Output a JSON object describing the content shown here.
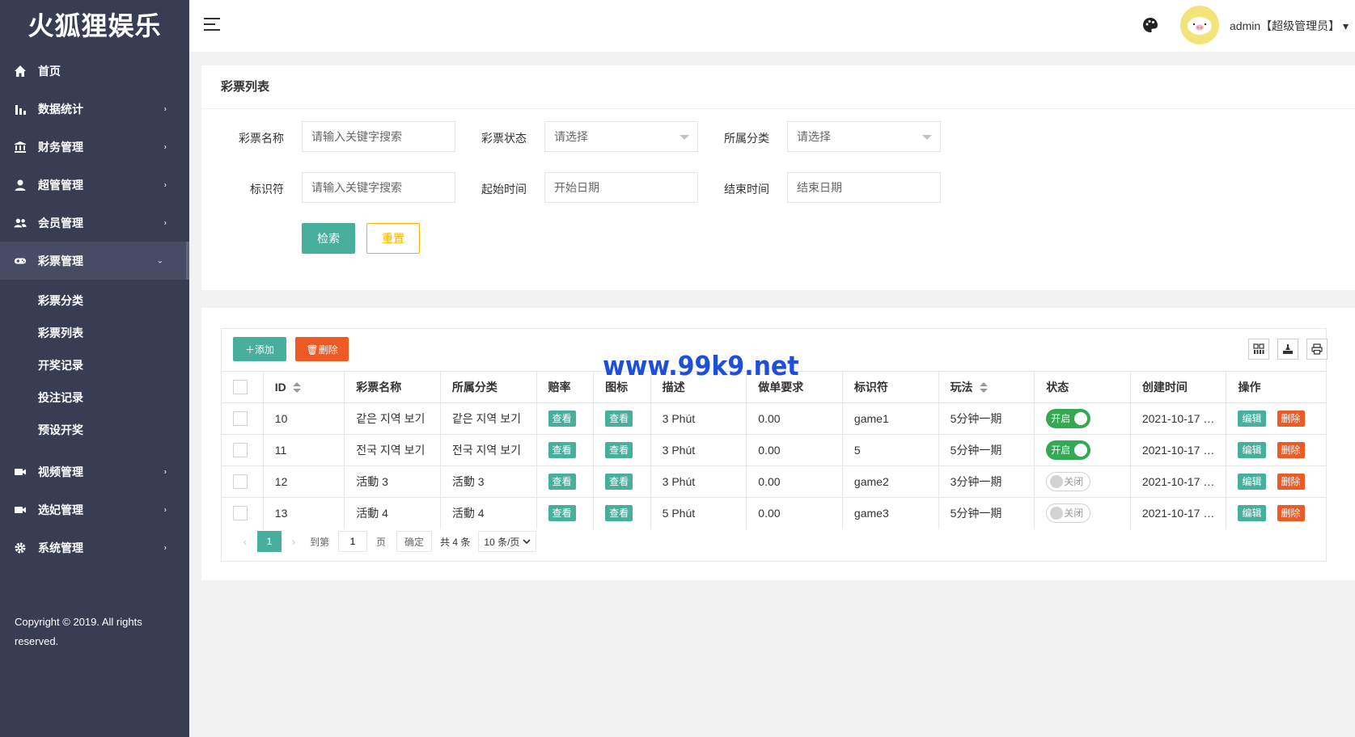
{
  "app": {
    "logo": "火狐狸娱乐",
    "copyright": "Copyright © 2019. All rights reserved."
  },
  "sidebar": {
    "items": [
      {
        "label": "首页",
        "icon": "home-icon",
        "arrow": ""
      },
      {
        "label": "数据统计",
        "icon": "bar-chart-icon",
        "arrow": "›"
      },
      {
        "label": "财务管理",
        "icon": "bank-icon",
        "arrow": "›"
      },
      {
        "label": "超管管理",
        "icon": "user-icon",
        "arrow": "›"
      },
      {
        "label": "会员管理",
        "icon": "users-icon",
        "arrow": "›"
      },
      {
        "label": "彩票管理",
        "icon": "gamepad-icon",
        "arrow": "⌄"
      },
      {
        "label": "视频管理",
        "icon": "video-icon",
        "arrow": "›"
      },
      {
        "label": "选妃管理",
        "icon": "video-icon",
        "arrow": "›"
      },
      {
        "label": "系统管理",
        "icon": "gear-icon",
        "arrow": "›"
      }
    ],
    "submenu": [
      "彩票分类",
      "彩票列表",
      "开奖记录",
      "投注记录",
      "预设开奖"
    ]
  },
  "header": {
    "admin_label": "admin【超级管理员】",
    "dropdown_caret": "▾"
  },
  "search": {
    "title": "彩票列表",
    "name_label": "彩票名称",
    "name_placeholder": "请输入关键字搜索",
    "status_label": "彩票状态",
    "status_value": "请选择",
    "category_label": "所属分类",
    "category_value": "请选择",
    "key_label": "标识符",
    "key_placeholder": "请输入关键字搜索",
    "start_label": "起始时间",
    "start_placeholder": "开始日期",
    "end_label": "结束时间",
    "end_placeholder": "结束日期",
    "search_button": "检索",
    "reset_button": "重置"
  },
  "toolbar": {
    "add_button": "＋添加",
    "delete_button": "🗑删除"
  },
  "table": {
    "columns": [
      "ID",
      "彩票名称",
      "所属分类",
      "赔率",
      "图标",
      "描述",
      "做单要求",
      "标识符",
      "玩法",
      "状态",
      "创建时间",
      "操作"
    ],
    "view_label": "查看",
    "edit_label": "编辑",
    "delete_label": "删除",
    "rows": [
      {
        "id": "10",
        "name": "같은 지역 보기",
        "category": "같은 지역 보기",
        "desc": "3 Phút",
        "req": "0.00",
        "key": "game1",
        "play": "5分钟一期",
        "status": "开启",
        "on": true,
        "created": "2021-10-17 1..."
      },
      {
        "id": "11",
        "name": "전국 지역 보기",
        "category": "전국 지역 보기",
        "desc": "3 Phút",
        "req": "0.00",
        "key": "5",
        "play": "5分钟一期",
        "status": "开启",
        "on": true,
        "created": "2021-10-17 1..."
      },
      {
        "id": "12",
        "name": "活動 3",
        "category": "活動 3",
        "desc": "3 Phút",
        "req": "0.00",
        "key": "game2",
        "play": "3分钟一期",
        "status": "关闭",
        "on": false,
        "created": "2021-10-17 1..."
      },
      {
        "id": "13",
        "name": "活動 4",
        "category": "活動 4",
        "desc": "5 Phút",
        "req": "0.00",
        "key": "game3",
        "play": "5分钟一期",
        "status": "关闭",
        "on": false,
        "created": "2021-10-17 1..."
      }
    ]
  },
  "pager": {
    "prev": "‹",
    "current": "1",
    "next": "›",
    "goto_label": "到第",
    "goto_value": "1",
    "page_label": "页",
    "confirm": "确定",
    "total": "共 4 条",
    "page_size": "10 条/页"
  },
  "watermark": "www.99k9.net",
  "colors": {
    "sidebar": "#393d54",
    "primary": "#48af9c",
    "danger": "#ee5a24",
    "warning": "#f0b400",
    "switch_on": "#34a853"
  }
}
